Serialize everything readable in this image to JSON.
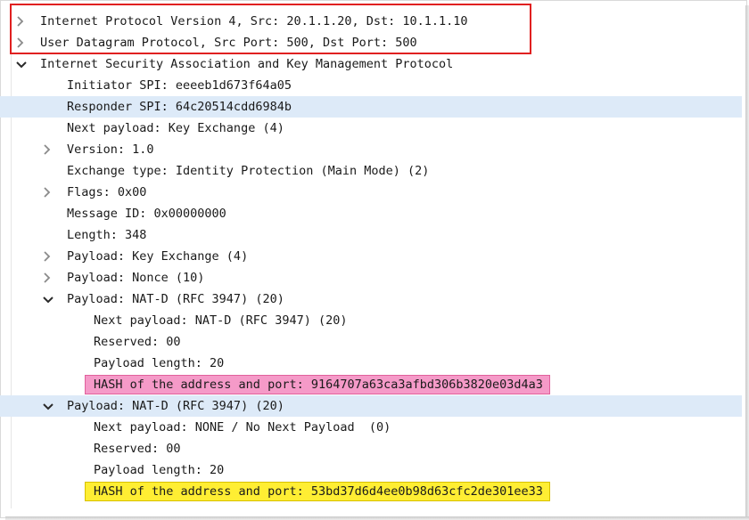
{
  "rows": [
    {
      "text": "Internet Protocol Version 4, Src: 20.1.1.20, Dst: 10.1.1.10",
      "indent": 0,
      "chevron": "right",
      "style": "dim"
    },
    {
      "text": "User Datagram Protocol, Src Port: 500, Dst Port: 500",
      "indent": 0,
      "chevron": "right",
      "style": "dim"
    },
    {
      "text": "Internet Security Association and Key Management Protocol",
      "indent": 0,
      "chevron": "down",
      "style": ""
    },
    {
      "text": "Initiator SPI: eeeeb1d673f64a05",
      "indent": 1,
      "chevron": "",
      "style": ""
    },
    {
      "text": "Responder SPI: 64c20514cdd6984b",
      "indent": 1,
      "chevron": "",
      "style": "sel"
    },
    {
      "text": "Next payload: Key Exchange (4)",
      "indent": 1,
      "chevron": "",
      "style": ""
    },
    {
      "text": "Version: 1.0",
      "indent": 1,
      "chevron": "right",
      "style": ""
    },
    {
      "text": "Exchange type: Identity Protection (Main Mode) (2)",
      "indent": 1,
      "chevron": "",
      "style": ""
    },
    {
      "text": "Flags: 0x00",
      "indent": 1,
      "chevron": "right",
      "style": ""
    },
    {
      "text": "Message ID: 0x00000000",
      "indent": 1,
      "chevron": "",
      "style": ""
    },
    {
      "text": "Length: 348",
      "indent": 1,
      "chevron": "",
      "style": ""
    },
    {
      "text": "Payload: Key Exchange (4)",
      "indent": 1,
      "chevron": "right",
      "style": ""
    },
    {
      "text": "Payload: Nonce (10)",
      "indent": 1,
      "chevron": "right",
      "style": ""
    },
    {
      "text": "Payload: NAT-D (RFC 3947) (20)",
      "indent": 1,
      "chevron": "down",
      "style": ""
    },
    {
      "text": "Next payload: NAT-D (RFC 3947) (20)",
      "indent": 2,
      "chevron": "",
      "style": ""
    },
    {
      "text": "Reserved: 00",
      "indent": 2,
      "chevron": "",
      "style": ""
    },
    {
      "text": "Payload length: 20",
      "indent": 2,
      "chevron": "",
      "style": ""
    },
    {
      "text": "HASH of the address and port: 9164707a63ca3afbd306b3820e03d4a3",
      "indent": 2,
      "chevron": "",
      "style": "pink"
    },
    {
      "text": "Payload: NAT-D (RFC 3947) (20)",
      "indent": 1,
      "chevron": "down",
      "style": "sel"
    },
    {
      "text": "Next payload: NONE / No Next Payload  (0)",
      "indent": 2,
      "chevron": "",
      "style": ""
    },
    {
      "text": "Reserved: 00",
      "indent": 2,
      "chevron": "",
      "style": ""
    },
    {
      "text": "Payload length: 20",
      "indent": 2,
      "chevron": "",
      "style": ""
    },
    {
      "text": "HASH of the address and port: 53bd37d6d4ee0b98d63cfc2de301ee33",
      "indent": 2,
      "chevron": "",
      "style": "yellow"
    }
  ],
  "colors": {
    "selected_row": "#ddeaf8",
    "pink_highlight": "#f59ac8",
    "yellow_highlight": "#ffee33",
    "red_box": "#e02020"
  }
}
